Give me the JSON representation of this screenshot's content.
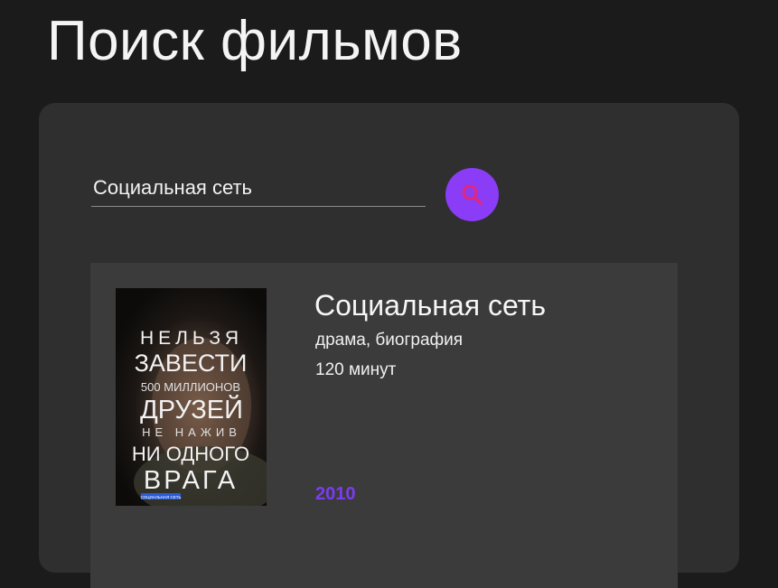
{
  "page": {
    "title": "Поиск фильмов"
  },
  "search": {
    "value": "Социальная сеть",
    "button_icon": "search-icon"
  },
  "colors": {
    "background": "#1b1b1b",
    "panel": "#2f2f2f",
    "card": "#3b3b3b",
    "accent": "#8a3cf7",
    "year": "#7b3cf0"
  },
  "results": [
    {
      "title": "Социальная сеть",
      "genres": "драма, биография",
      "duration": "120 минут",
      "year": "2010",
      "poster": {
        "lines": [
          "НЕЛЬЗЯ",
          "ЗАВЕСТИ",
          "500 МИЛЛИОНОВ",
          "ДРУЗЕЙ",
          "НЕ НАЖИВ",
          "НИ ОДНОГО",
          "ВРАГА"
        ],
        "badge": "СОЦИАЛЬНАЯ СЕТЬ"
      }
    }
  ]
}
